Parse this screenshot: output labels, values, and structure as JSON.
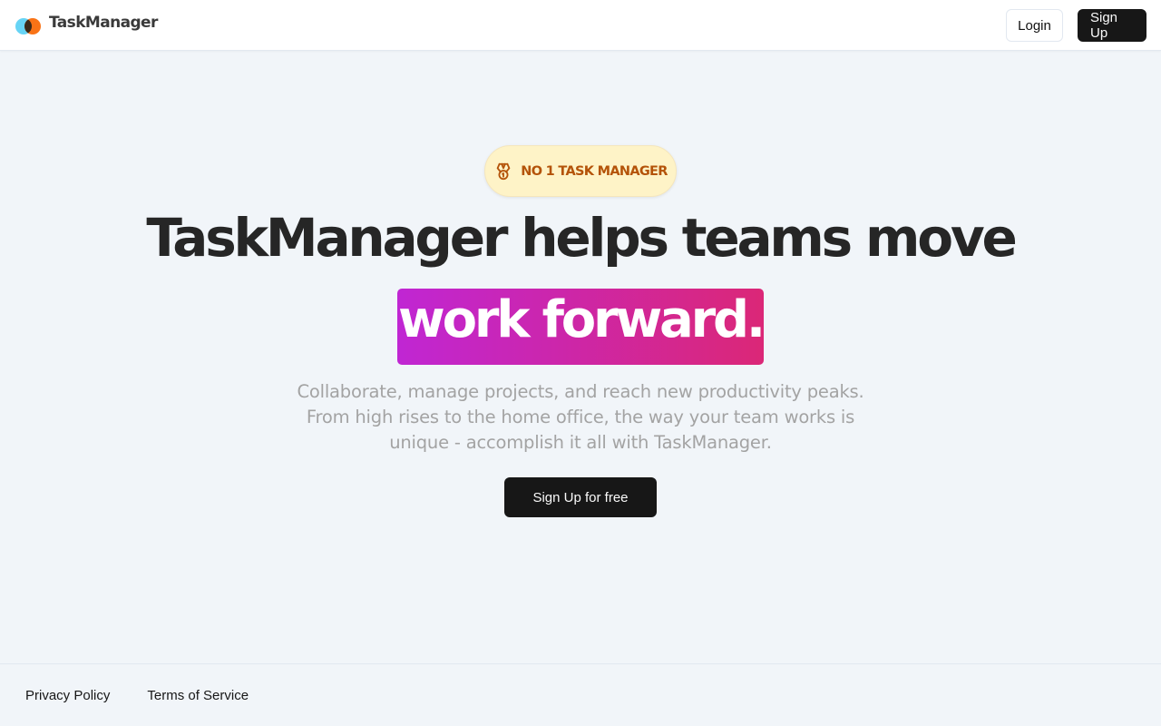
{
  "navbar": {
    "brand_name": "TaskManager",
    "logo_icon": "two-overlapping-circles-logo",
    "login_label": "Login",
    "signup_label": "Sign Up"
  },
  "hero": {
    "badge_icon": "medal-icon",
    "badge_text": "No 1 task manager",
    "headline": "TaskManager helps teams move",
    "highlight": "work forward.",
    "subtext_lines": [
      "Collaborate, manage projects, and reach new productivity peaks.",
      "From high rises to the home office, the way your team works is",
      "unique - accomplish it all with TaskManager."
    ],
    "cta_label": "Sign Up for free"
  },
  "footer": {
    "links": [
      "Privacy Policy",
      "Terms of Service"
    ]
  },
  "colors": {
    "page_background": "#f1f5f9",
    "primary_button": "#171717",
    "badge_background": "#fef3c7",
    "badge_text": "#b45309",
    "highlight_gradient_start": "#c026d3",
    "highlight_gradient_end": "#db2777",
    "logo_cyan": "#67d4f5",
    "logo_orange": "#f97316"
  }
}
